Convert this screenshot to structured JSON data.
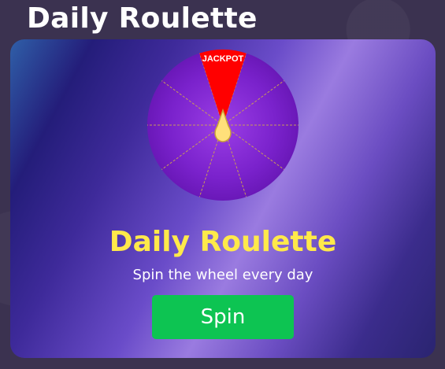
{
  "header": {
    "title": "Daily Roulette"
  },
  "card": {
    "title": "Daily Roulette",
    "subtitle": "Spin the wheel every day",
    "spin_label": "Spin"
  },
  "wheel": {
    "jackpot_label": "JACKPOT",
    "segment_count": 10,
    "colors": {
      "wheel_fill": "#7a22cc",
      "jackpot_fill": "#ff0000",
      "divider": "#c99a5a",
      "pointer": "#ffe07a"
    }
  },
  "icons": {
    "pointer": "wheel-pointer-icon"
  }
}
